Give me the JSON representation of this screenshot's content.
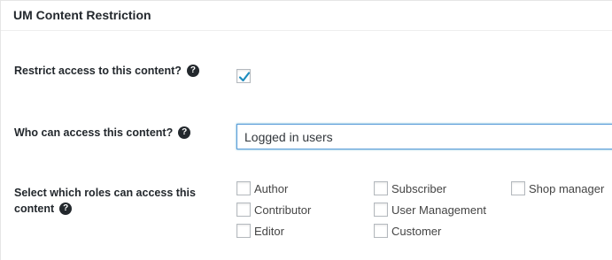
{
  "panel": {
    "title": "UM Content Restriction"
  },
  "restrict": {
    "label": "Restrict access to this content?",
    "help_icon": "?",
    "checked": true
  },
  "who": {
    "label": "Who can access this content?",
    "help_icon": "?",
    "selected": "Logged in users"
  },
  "roles": {
    "label": "Select which roles can access this content",
    "help_icon": "?",
    "items": [
      {
        "label": "Author",
        "checked": false
      },
      {
        "label": "Contributor",
        "checked": false
      },
      {
        "label": "Editor",
        "checked": false
      },
      {
        "label": "Subscriber",
        "checked": false
      },
      {
        "label": "User Management",
        "checked": false
      },
      {
        "label": "Customer",
        "checked": false
      },
      {
        "label": "Shop manager",
        "checked": false
      }
    ]
  },
  "colors": {
    "check_mark": "#1e8cbe",
    "focus_border": "#5b9dd9"
  }
}
